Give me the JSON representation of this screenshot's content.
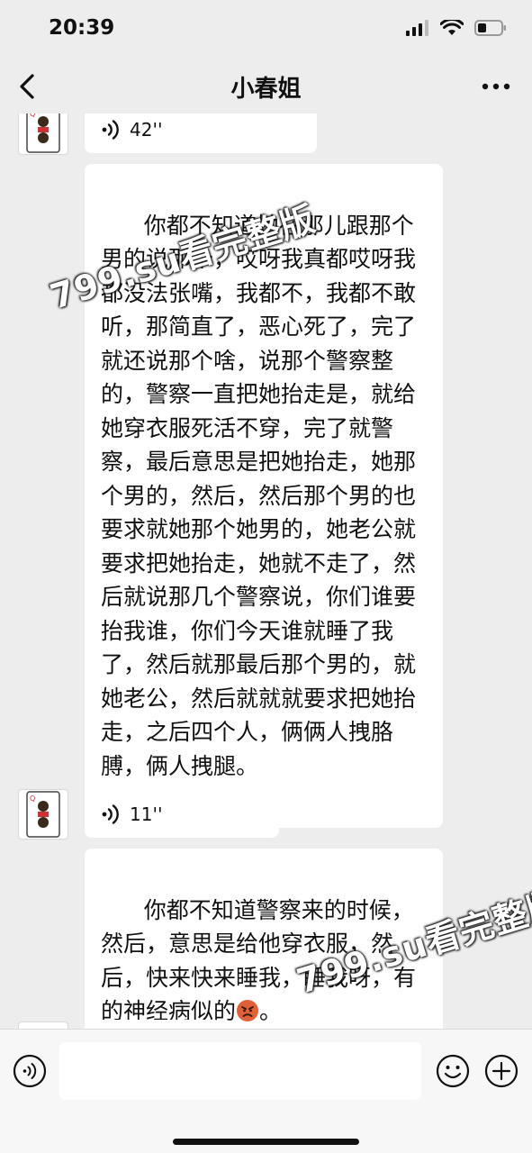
{
  "status_bar": {
    "time": "20:39",
    "icons": [
      "signal-icon",
      "wifi-icon",
      "battery-icon"
    ]
  },
  "nav": {
    "title": "小春姐",
    "back_icon": "chevron-left-icon",
    "more_icon": "more-dots-icon"
  },
  "messages": [
    {
      "type": "voice",
      "duration": "42''"
    },
    {
      "type": "text",
      "text": "你都不知道她在那儿跟那个男的说那个，哎呀我真都哎呀我都没法张嘴，我都不，我都不敢听，那简直了，恶心死了，完了就还说那个啥，说那个警察整的，警察一直把她抬走是，就给她穿衣服死活不穿，完了就警察，最后意思是把她抬走，她那个男的，然后，然后那个男的也要求就她那个她男的，她老公就要求把她抬走，她就不走了，然后就说那几个警察说，你们谁要抬我谁，你们今天谁就睡了我了，然后就那最后那个男的，就她老公，然后就就就要求把她抬走，之后四个人，俩俩人拽胳膊，俩人拽腿。"
    },
    {
      "type": "voice",
      "duration": "11''"
    },
    {
      "type": "text",
      "text": "你都不知道警察来的时候，然后，意思是给他穿衣服，然后，快来快来睡我，睡我呀，有的神经病似的",
      "suffix": "。",
      "emoji": "angry-face-icon"
    }
  ],
  "watermarks": [
    "799.su看完整版",
    "799.su看完整版"
  ],
  "input_bar": {
    "placeholder": "",
    "voice_icon": "voice-toggle-icon",
    "emoji_icon": "smiley-icon",
    "plus_icon": "plus-circle-icon"
  },
  "colors": {
    "background": "#ededed",
    "bubble": "#ffffff",
    "input_bar": "#f7f7f7"
  }
}
